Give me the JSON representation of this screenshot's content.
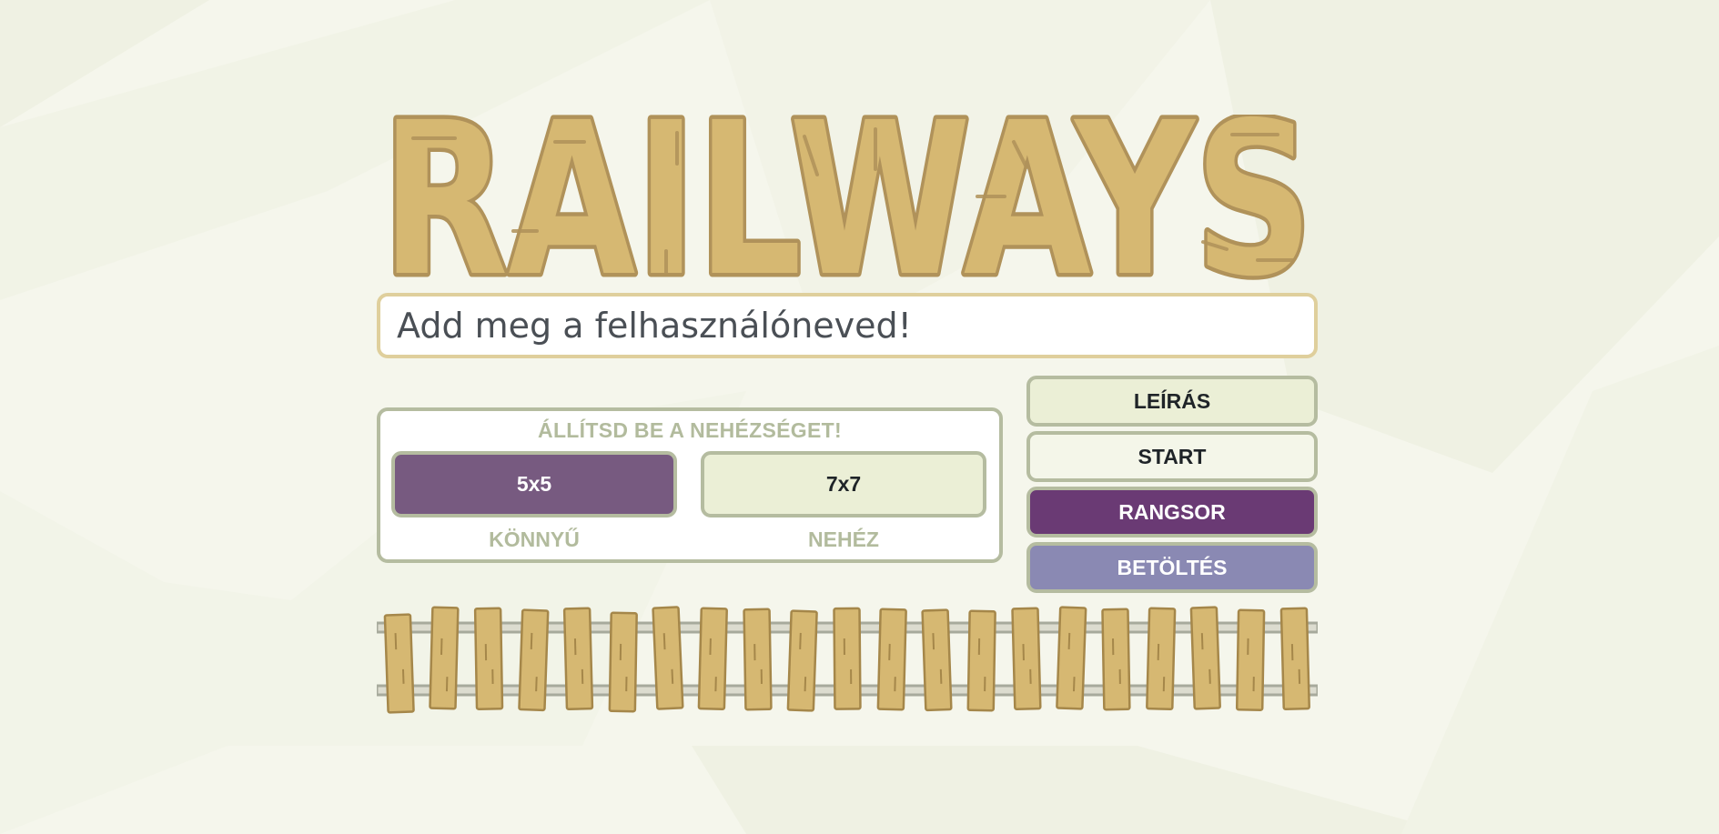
{
  "colors": {
    "background": "#f5f6ec",
    "logo_fill": "#d6b872",
    "logo_outline": "#b0925a",
    "input_border": "#dfcf9c",
    "panel_border": "#b5bca0",
    "muted_text": "#b2bb9d",
    "purple_selected": "#775a80",
    "light_green": "#ebefd6",
    "start_bg": "#f4f6e9",
    "rangsor_bg": "#6a3a74",
    "betoltes_bg": "#8a89b3",
    "tie_fill": "#d6b872",
    "rail_color": "#a7aa9c"
  },
  "logo": {
    "text": "RAILWAYS"
  },
  "username": {
    "placeholder": "Add meg a felhasználóneved!",
    "value": ""
  },
  "difficulty": {
    "title": "ÁLLÍTSD BE A NEHÉZSÉGET!",
    "options": [
      {
        "label": "5x5",
        "caption": "KÖNNYŰ",
        "selected": true
      },
      {
        "label": "7x7",
        "caption": "NEHÉZ",
        "selected": false
      }
    ]
  },
  "menu": {
    "leiras": "LEÍRÁS",
    "start": "START",
    "rangsor": "RANGSOR",
    "betoltes": "BETÖLTÉS"
  },
  "decor": {
    "railway_track_icon": "railway-track"
  }
}
